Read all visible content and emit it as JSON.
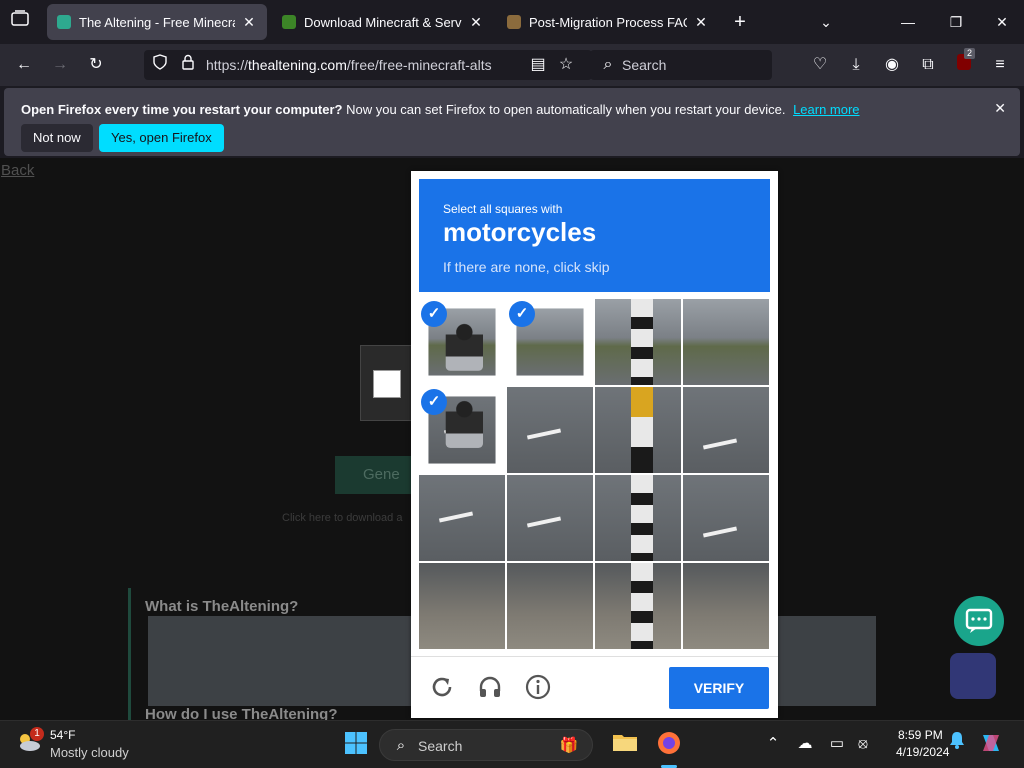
{
  "browser": {
    "tabs": [
      {
        "title": "The Altening - Free Minecraft A",
        "active": true,
        "favicon_color": "#2ea98f"
      },
      {
        "title": "Download Minecraft & Server S",
        "active": false,
        "favicon_color": "#3c8527"
      },
      {
        "title": "Post-Migration Process FAQ | M",
        "active": false,
        "favicon_color": "#8b6b3d"
      }
    ],
    "url_scheme": "https://",
    "url_host": "thealtening.com",
    "url_path": "/free/free-minecraft-alts",
    "search_placeholder": "Search",
    "extension_badge": "2"
  },
  "notification": {
    "bold_text": "Open Firefox every time you restart your computer?",
    "text": "Now you can set Firefox to open automatically when you restart your device.",
    "link": "Learn more",
    "not_now": "Not now",
    "yes": "Yes, open Firefox"
  },
  "page": {
    "back": "Back",
    "generate": "Gene",
    "download_hint": "Click here to download a",
    "faq_q1": "What is TheAltening?",
    "faq_q2": "How do I use TheAltening?"
  },
  "captcha": {
    "line1": "Select all squares with",
    "target": "motorcycles",
    "line3": "If there are none, click skip",
    "verify": "VERIFY",
    "selected_tiles": [
      0,
      1,
      4
    ],
    "check_glyph": "✓"
  },
  "taskbar": {
    "weather_temp": "54°F",
    "weather_desc": "Mostly cloudy",
    "weather_badge": "1",
    "search_label": "Search",
    "time": "8:59 PM",
    "date": "4/19/2024"
  }
}
